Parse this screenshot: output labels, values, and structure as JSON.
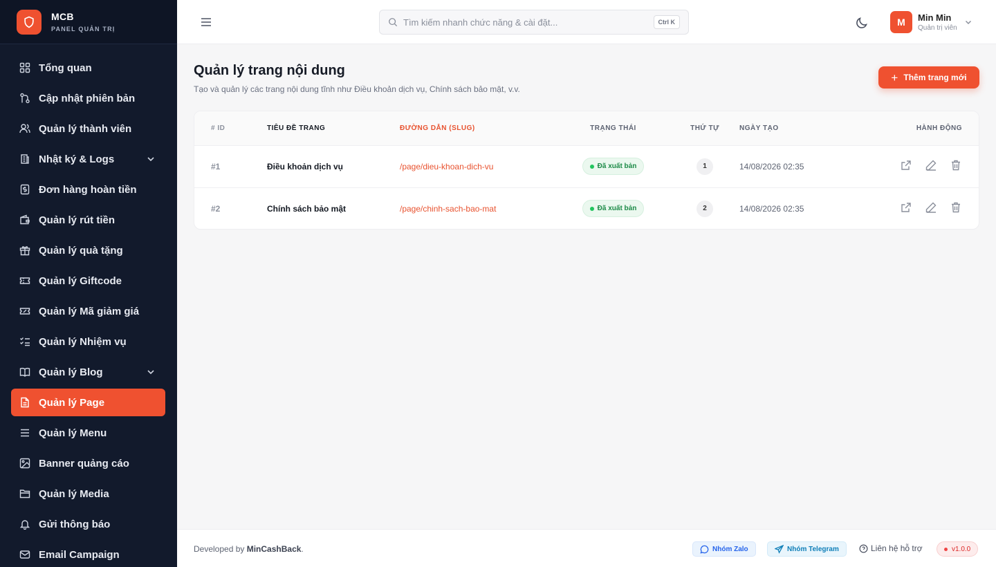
{
  "brand": {
    "name": "MCB",
    "subtitle": "PANEL QUẢN TRỊ"
  },
  "sidebar": {
    "items": [
      {
        "label": "Tổng quan",
        "icon": "grid-icon"
      },
      {
        "label": "Cập nhật phiên bản",
        "icon": "git-icon"
      },
      {
        "label": "Quản lý thành viên",
        "icon": "users-icon"
      },
      {
        "label": "Nhật ký & Logs",
        "icon": "log-icon",
        "expandable": true
      },
      {
        "label": "Đơn hàng hoàn tiền",
        "icon": "receipt-icon"
      },
      {
        "label": "Quản lý rút tiền",
        "icon": "wallet-icon"
      },
      {
        "label": "Quản lý quà tặng",
        "icon": "gift-icon"
      },
      {
        "label": "Quản lý Giftcode",
        "icon": "ticket-icon"
      },
      {
        "label": "Quản lý Mã giảm giá",
        "icon": "coupon-icon"
      },
      {
        "label": "Quản lý Nhiệm vụ",
        "icon": "checklist-icon"
      },
      {
        "label": "Quản lý Blog",
        "icon": "book-icon",
        "expandable": true
      },
      {
        "label": "Quản lý Page",
        "icon": "page-icon",
        "active": true
      },
      {
        "label": "Quản lý Menu",
        "icon": "menu-icon"
      },
      {
        "label": "Banner quảng cáo",
        "icon": "image-icon"
      },
      {
        "label": "Quản lý Media",
        "icon": "folder-icon"
      },
      {
        "label": "Gửi thông báo",
        "icon": "bell-icon"
      },
      {
        "label": "Email Campaign",
        "icon": "mail-icon"
      }
    ]
  },
  "topbar": {
    "search_placeholder": "Tìm kiếm nhanh chức năng & cài đặt...",
    "search_shortcut": "Ctrl K",
    "user": {
      "initial": "M",
      "name": "Min Min",
      "role": "Quản trị viên"
    }
  },
  "main": {
    "title": "Quản lý trang nội dung",
    "description": "Tạo và quản lý các trang nội dung tĩnh như Điều khoản dịch vụ, Chính sách bảo mật, v.v.",
    "add_button": "Thêm trang mới",
    "table": {
      "headers": [
        "# ID",
        "TIÊU ĐỀ TRANG",
        "ĐƯỜNG DẪN (SLUG)",
        "TRẠNG THÁI",
        "THỨ TỰ",
        "NGÀY TẠO",
        "HÀNH ĐỘNG"
      ],
      "rows": [
        {
          "id": "#1",
          "title": "Điều khoản dịch vụ",
          "slug": "/page/dieu-khoan-dich-vu",
          "status": "Đã xuất bản",
          "order": "1",
          "created": "14/08/2026 02:35"
        },
        {
          "id": "#2",
          "title": "Chính sách bảo mật",
          "slug": "/page/chinh-sach-bao-mat",
          "status": "Đã xuất bản",
          "order": "2",
          "created": "14/08/2026 02:35"
        }
      ]
    }
  },
  "footer": {
    "developed_prefix": "Developed by ",
    "developer": "MinCashBack",
    "developed_suffix": ".",
    "zalo": "Nhóm Zalo",
    "telegram": "Nhóm Telegram",
    "support": "Liên hệ hỗ trợ",
    "version": "v1.0.0"
  },
  "colors": {
    "accent": "#ef5130",
    "sidebar_bg": "#121a2c",
    "success": "#22c55e"
  }
}
